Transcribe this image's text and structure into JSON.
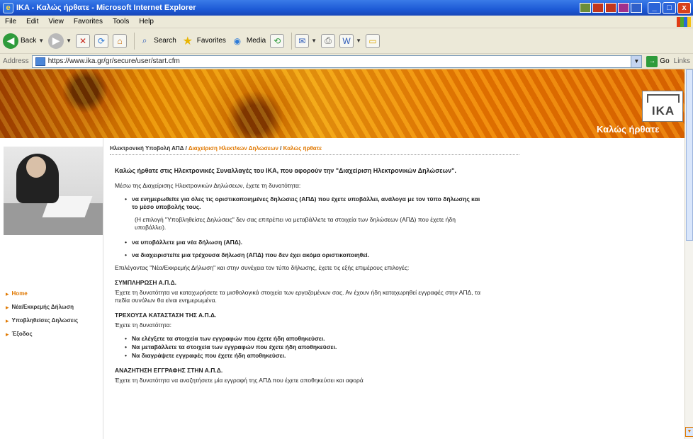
{
  "window": {
    "title": "IKA - Καλώς ήρθατε - Microsoft Internet Explorer",
    "minimize": "_",
    "maximize": "□",
    "close": "x"
  },
  "menu": [
    "File",
    "Edit",
    "View",
    "Favorites",
    "Tools",
    "Help"
  ],
  "toolbar": {
    "back": "Back",
    "search": "Search",
    "favorites": "Favorites",
    "media": "Media"
  },
  "address": {
    "label": "Address",
    "url": "https://www.ika.gr/gr/secure/user/start.cfm",
    "go": "Go",
    "links": "Links"
  },
  "banner": {
    "logo_text": "IKA",
    "welcome": "Καλώς ήρθατε"
  },
  "breadcrumb": {
    "item1": "Ηλεκτρονική Υποβολή ΑΠΔ",
    "sep": " / ",
    "item2": "Διαχείριση Ηλεκτ/κών Δηλώσεων",
    "item3": "Καλώς ήρθατε"
  },
  "nav": [
    {
      "label": "Home"
    },
    {
      "label": "Νέα/Εκκρεμής Δήλωση"
    },
    {
      "label": "Υποβληθείσες Δηλώσεις"
    },
    {
      "label": "Έξοδος"
    }
  ],
  "content": {
    "intro": "Καλώς ήρθατε στις Ηλεκτρονικές Συναλλαγές του ΙΚΑ, που αφορούν την \"Διαχείριση Ηλεκτρονικών Δηλώσεων\".",
    "via": "Μέσω της Διαχείρισης Ηλεκτρονικών Δηλώσεων, έχετε τη δυνατότητα:",
    "bullet1": "να ενημερωθείτε για όλες τις οριστικοποιημένες δηλώσεις (ΑΠΔ) που έχετε υποβάλλει, ανάλογα με τον τύπο δήλωσης και το μέσο υποβολής τους.",
    "note": "(Η επιλογή \"Υποβληθείσες Δηλώσεις\" δεν σας επιτρέπει να μεταβάλλετε τα στοιχεία των δηλώσεων (ΑΠΔ) που έχετε ήδη υποβάλλει).",
    "bullet2": "να υποβάλλετε μια νέα δήλωση (ΑΠΔ).",
    "bullet3": "να διαχειριστείτε μια τρέχουσα δήλωση (ΑΠΔ) που δεν έχει ακόμα οριστικοποιηθεί.",
    "choose": "Επιλέγοντας \"Νέα/Εκκρεμής Δήλωση\" και στην συνέχεια τον τύπο δήλωσης, έχετε τις εξής επιμέρους επιλογές:",
    "h1": "ΣΥΜΠΛΗΡΩΣΗ Α.Π.Δ.",
    "p1": "Έχετε τη δυνατότητα να καταχωρήσετε τα μισθολογικά στοιχεία των εργαζομένων σας. Αν έχουν ήδη καταχωρηθεί εγγραφές στην ΑΠΔ, τα πεδία συνόλων θα είναι ενημερωμένα.",
    "h2": "ΤΡΕΧΟΥΣΑ ΚΑΤΑΣΤΑΣΗ ΤΗΣ Α.Π.Δ.",
    "p2": "Έχετε τη δυνατότητα:",
    "b4": "Να ελέγξετε τα στοιχεία των εγγραφών που έχετε ήδη αποθηκεύσει.",
    "b5": "Να μεταβάλλετε τα στοιχεία των εγγραφών που έχετε ήδη αποθηκεύσει.",
    "b6": "Να διαγράψετε εγγραφές που έχετε ήδη αποθηκεύσει.",
    "h3": "ΑΝΑΖΗΤΗΣΗ ΕΓΓΡΑΦΗΣ ΣΤΗΝ Α.Π.Δ.",
    "p3": "Έχετε τη δυνατότητα να αναζητήσετε μία εγγραφή της ΑΠΔ που έχετε αποθηκεύσει και αφορά"
  }
}
